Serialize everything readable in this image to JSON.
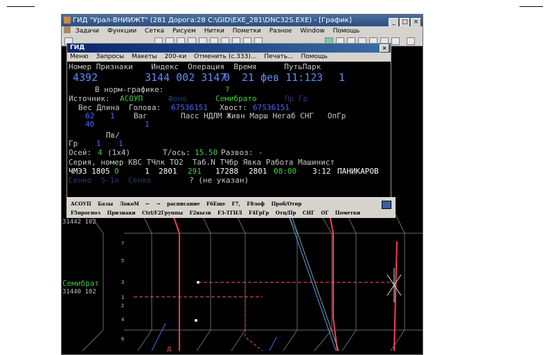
{
  "window": {
    "title": "ГИД \"Урал-ВНИИЖТ\" (281 Дорога:28 C:\\GID\\EXE_281\\DNC32S.EXE) - [График]",
    "menu": [
      "Задачи",
      "Функции",
      "Сетка",
      "Рисуем",
      "Нитки",
      "Пометки",
      "Разное",
      "Window",
      "Помощь"
    ]
  },
  "dialog": {
    "title": "ГИД",
    "menu": [
      "Меню",
      "Запросы",
      "Макеты",
      "200-ки",
      "Отменить (с.333)...",
      "Печать...",
      "Помощь"
    ],
    "header_row": "Номер Признаки    Индекс  Операция  Время      ПутьПарк",
    "train_number": "4392",
    "index": "3144 002 3147",
    "operation": "0",
    "time": "21 фев 11:12",
    "track": "3",
    "park": "1",
    "norm_label": "В норм-графике:",
    "norm_value": "?",
    "source_label": "Источник:",
    "source_value": "АСОУП",
    "source_dim": "Фоно",
    "station_value": "Семибрато",
    "source_dim2": "Пр Гр",
    "ves_row": "Вес Длина  Голова:",
    "head_value": "67536151",
    "tail_label": "Хвост:",
    "tail_value": "67536151",
    "weight": "62",
    "length": "1",
    "vag_label": "Ваг",
    "cols_row": "Пасс НДЛМ Живн Марш Негаб СНГ   ОпГр",
    "weight2": "40",
    "vag_value": "1",
    "pv_label": "Пв/",
    "gr_label": "Гр",
    "gr_val1": "1",
    "gr_val2": "1",
    "axles_label": "Осей:",
    "axles_value": "4",
    "axles_extra": "(1х4)",
    "tos_label": "Т/ось:",
    "tos_value": "15.50",
    "razvoz_label": "Развоз:",
    "razvoz_value": "-",
    "loco_header": "Серия, номер КВС ТЧлк ТО2  Таб.N ТЧбр Явка Работа Машинист",
    "loco_series": "ЧМЭЗ 1805",
    "loco_suffix": "0",
    "kvs": "1",
    "tchlk": "2801",
    "to2": "291",
    "tab_n": "17288",
    "tchbr": "2801",
    "yavka": "08:00",
    "rabota": "3:12",
    "driver": "ПАНИКАРОВ",
    "last_row": "? (не указан)",
    "last_dim": "Сенко  5-1н  Сенко"
  },
  "status_bar": {
    "row1": [
      "АСОУП",
      "Базы",
      "ЛокоМ",
      "←",
      "→",
      "расписание",
      "F6Еще",
      "F7,",
      "F8лоф",
      "Проб/Отпр"
    ],
    "row2": [
      "F5прогноз",
      "Признаки",
      "Ctrl/F2Группы",
      "F2вызв",
      "F3-ТГНЛ",
      "F4ГрГр",
      "Отц/Пр",
      "СНГ",
      "ОГ",
      "Пометки"
    ]
  },
  "graph": {
    "side_labels": [
      "31442 102",
      "31440 102"
    ],
    "station_label": "Семибрат",
    "track_numbers": [
      "7",
      "5",
      "3",
      "1",
      "2",
      "4",
      "6"
    ],
    "small_label": "Д"
  }
}
